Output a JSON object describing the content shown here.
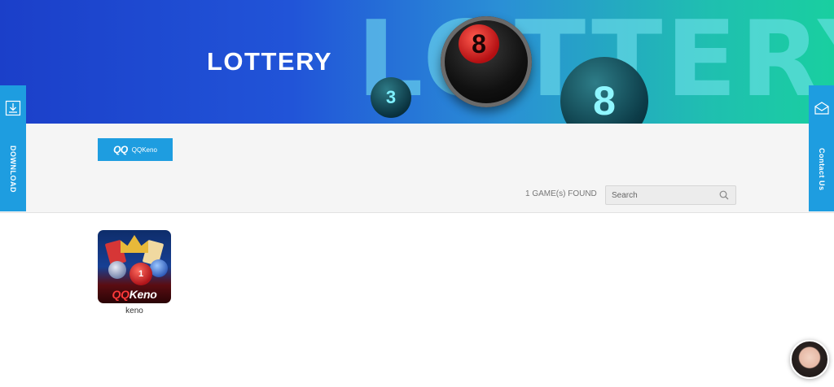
{
  "banner": {
    "title": "LOTTERY",
    "big_word": "LOTTERY",
    "ball_numbers": [
      "8",
      "3",
      "8"
    ]
  },
  "side_left": {
    "label": "DOWNLOAD",
    "icon": "download-icon"
  },
  "side_right": {
    "label": "Contact Us",
    "icon": "mail-icon"
  },
  "provider_tab": {
    "logo": "QQ",
    "label": "QQKeno"
  },
  "results": {
    "count_text": "1 GAME(s) FOUND"
  },
  "search": {
    "placeholder": "Search",
    "value": "",
    "icon": "search-icon"
  },
  "games": [
    {
      "name": "keno",
      "thumb_brand_prefix": "QQ",
      "thumb_brand_suffix": "Keno",
      "thumb_ball": "1"
    }
  ],
  "chat": {
    "icon": "chat-avatar"
  },
  "colors": {
    "accent": "#1e9de0",
    "banner_start": "#1b3fc9",
    "banner_end": "#19cfa0"
  }
}
